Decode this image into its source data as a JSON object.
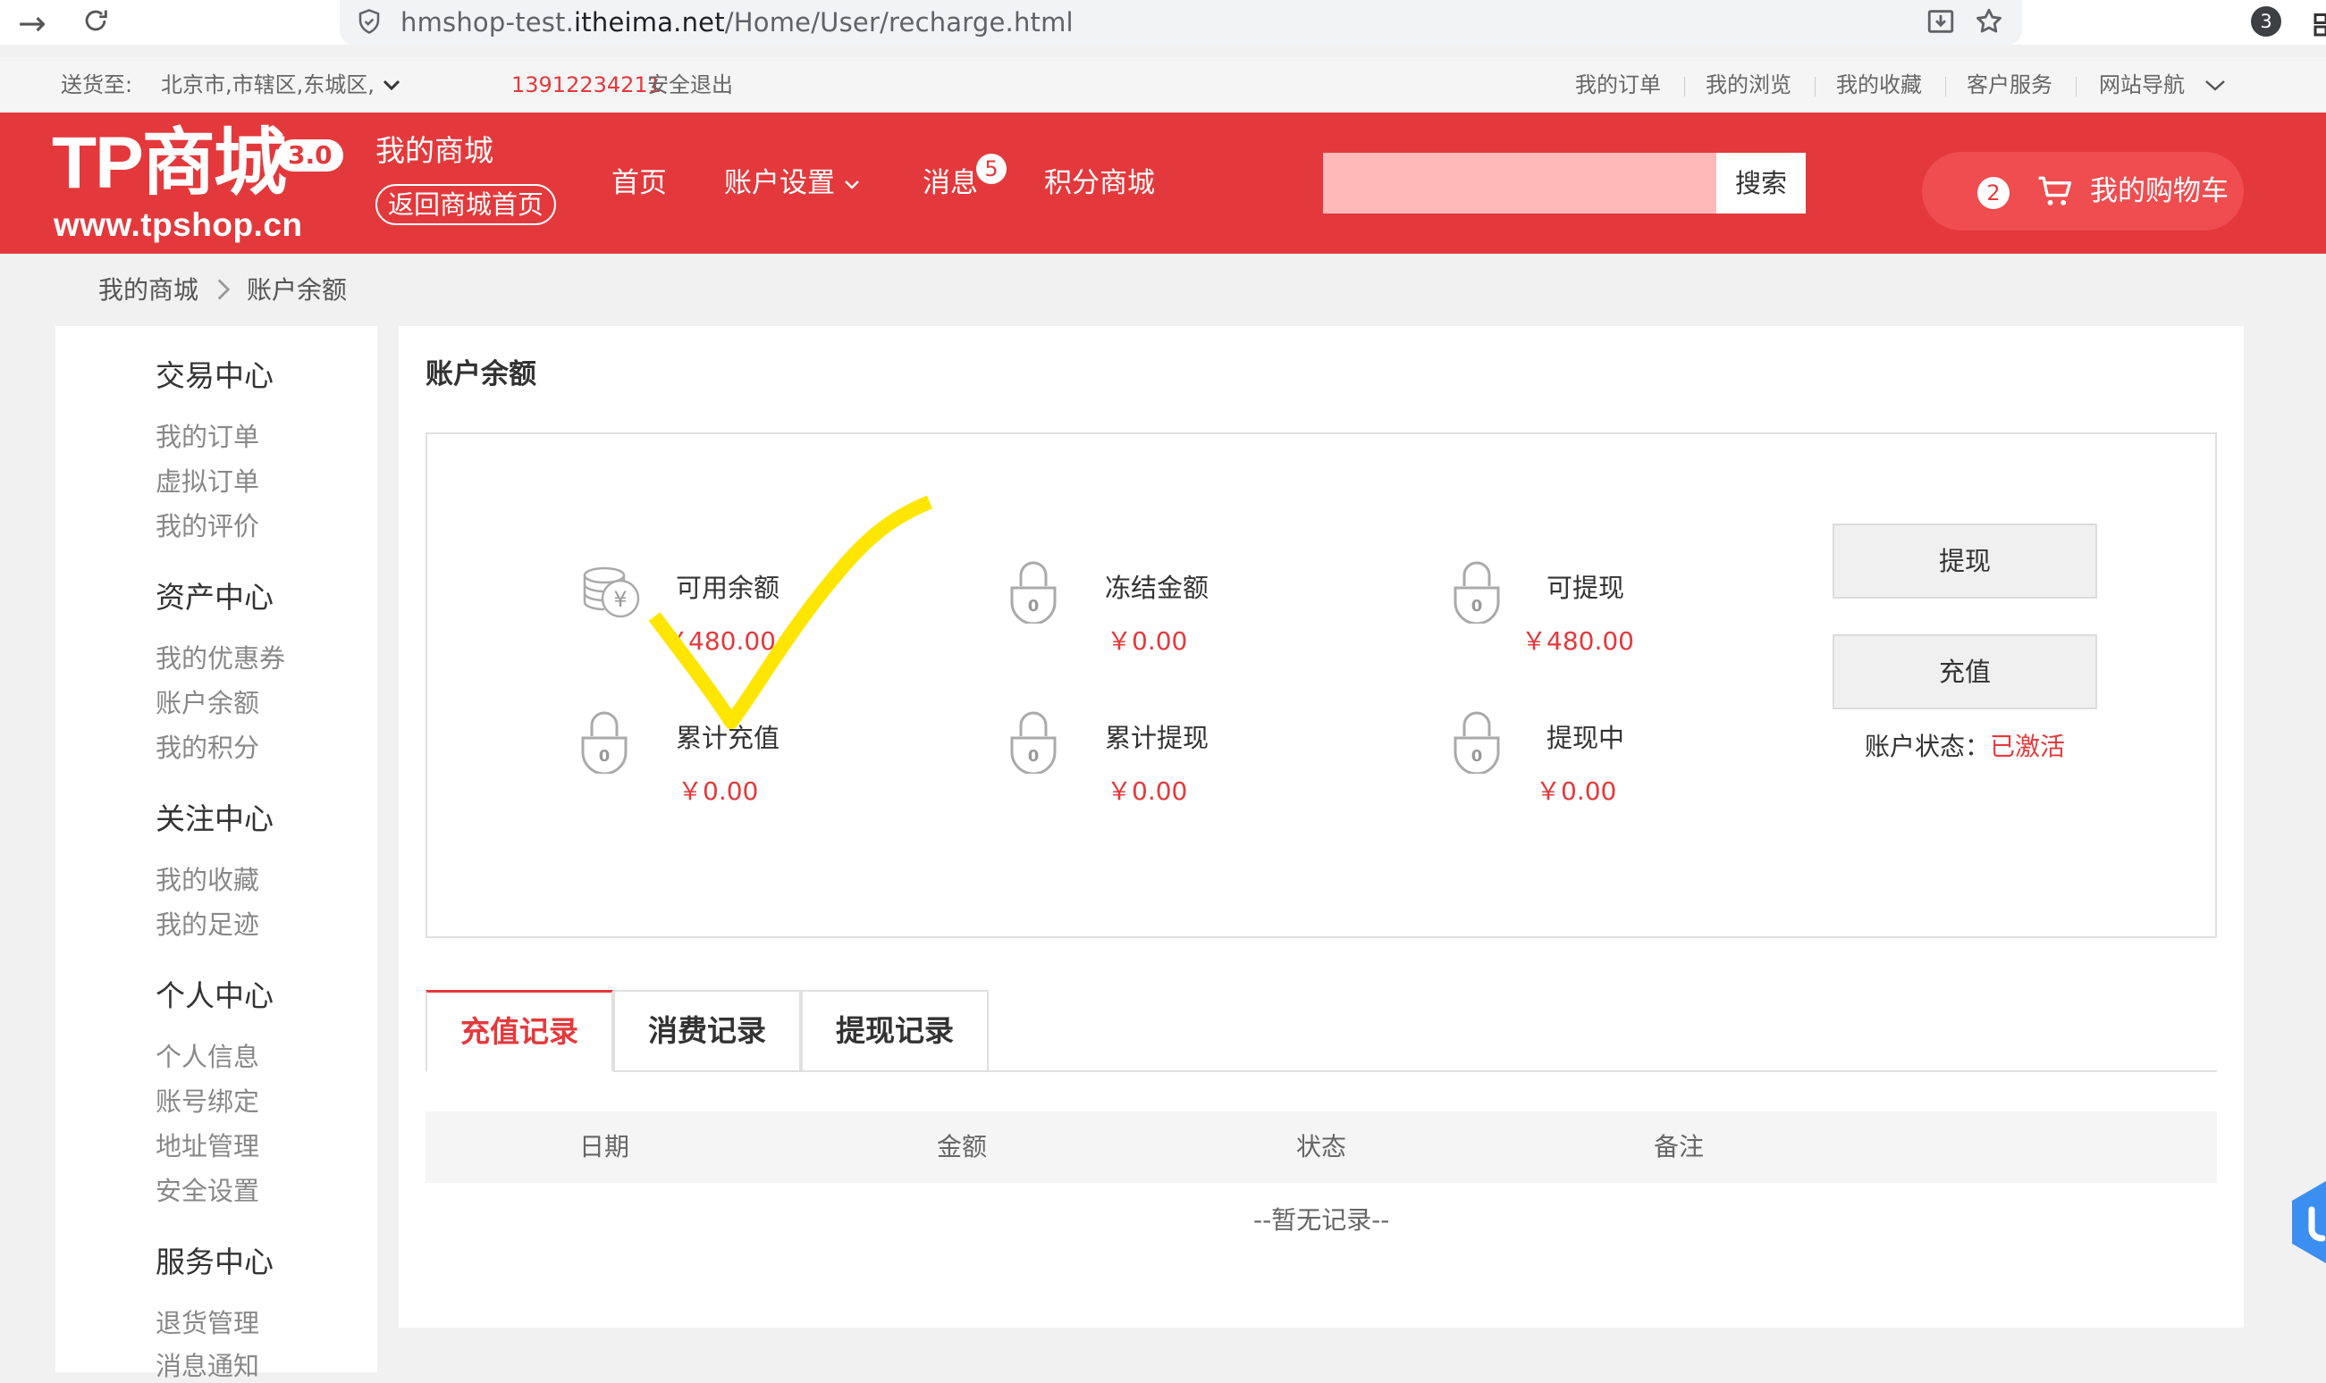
{
  "browser": {
    "url_prefix": "hmshop-test.",
    "url_domain": "itheima.net",
    "url_path": "/Home/User/recharge.html",
    "profile_badge": "3"
  },
  "topbar": {
    "ship_label": "送货至:",
    "location": "北京市,市辖区,东城区,",
    "phone": "13912234211",
    "logout": "安全退出",
    "links": [
      "我的订单",
      "我的浏览",
      "我的收藏",
      "客户服务",
      "网站导航"
    ]
  },
  "header": {
    "logo_text": "TP商城",
    "logo_version": "3.0",
    "logo_site": "www.tpshop.cn",
    "my_mall": "我的商城",
    "back_home": "返回商城首页",
    "nav": [
      "首页",
      "账户设置",
      "消息",
      "积分商城"
    ],
    "message_count": "5",
    "search_placeholder": "",
    "search_button": "搜索",
    "cart_count": "2",
    "cart_label": "我的购物车"
  },
  "breadcrumb": {
    "home": "我的商城",
    "current": "账户余额"
  },
  "sidebar": {
    "groups": [
      {
        "title": "交易中心",
        "items": [
          "我的订单",
          "虚拟订单",
          "我的评价"
        ]
      },
      {
        "title": "资产中心",
        "items": [
          "我的优惠券",
          "账户余额",
          "我的积分"
        ]
      },
      {
        "title": "关注中心",
        "items": [
          "我的收藏",
          "我的足迹"
        ]
      },
      {
        "title": "个人中心",
        "items": [
          "个人信息",
          "账号绑定",
          "地址管理",
          "安全设置"
        ]
      },
      {
        "title": "服务中心",
        "items": [
          "退货管理",
          "消息通知"
        ]
      }
    ]
  },
  "main": {
    "title": "账户余额",
    "balances": [
      {
        "label": "可用余额",
        "value": "￥480.00",
        "icon": "coins-icon"
      },
      {
        "label": "冻结金额",
        "value": "￥0.00",
        "icon": "lock-icon"
      },
      {
        "label": "可提现",
        "value": "￥480.00",
        "icon": "lock-icon"
      },
      {
        "label": "累计充值",
        "value": "￥0.00",
        "icon": "lock-icon"
      },
      {
        "label": "累计提现",
        "value": "￥0.00",
        "icon": "lock-icon"
      },
      {
        "label": "提现中",
        "value": "￥0.00",
        "icon": "lock-icon"
      }
    ],
    "withdraw_button": "提现",
    "recharge_button": "充值",
    "status_label": "账户状态：",
    "status_value": "已激活",
    "tabs": [
      "充值记录",
      "消费记录",
      "提现记录"
    ],
    "active_tab": "充值记录",
    "table_headers": [
      "日期",
      "金额",
      "状态",
      "备注"
    ],
    "empty_text": "--暂无记录--"
  },
  "colors": {
    "brand_red": "#e4393c",
    "annotation_yellow": "#ffe600"
  }
}
